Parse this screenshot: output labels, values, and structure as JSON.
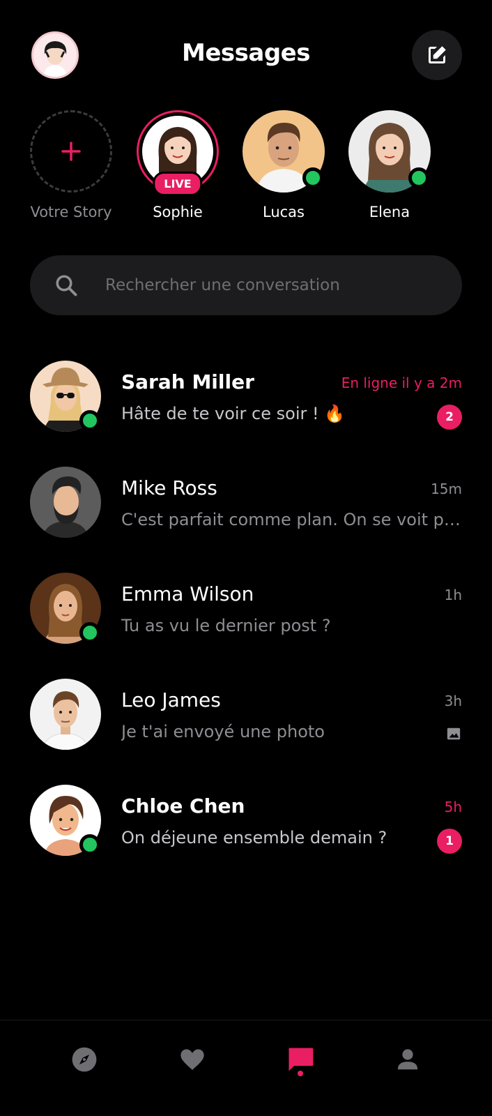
{
  "header": {
    "title": "Messages",
    "profile_icon": "user-avatar",
    "compose_icon": "edit-square-icon"
  },
  "stories": [
    {
      "name": "Votre Story",
      "type": "add",
      "icon": "plus-icon"
    },
    {
      "name": "Sophie",
      "type": "live",
      "badge": "LIVE"
    },
    {
      "name": "Lucas",
      "type": "online"
    },
    {
      "name": "Elena",
      "type": "online"
    }
  ],
  "search": {
    "placeholder": "Rechercher une conversation",
    "value": "",
    "icon": "search-icon"
  },
  "conversations": [
    {
      "name": "Sarah Miller",
      "preview": "Hâte de te voir ce soir ! 🔥",
      "time": "En ligne il y a 2m",
      "unread": "2",
      "online": true
    },
    {
      "name": "Mike Ross",
      "preview": "C'est parfait comme plan. On se voit plus tard.",
      "time": "15m",
      "online": false
    },
    {
      "name": "Emma Wilson",
      "preview": "Tu as vu le dernier post ?",
      "time": "1h",
      "online": true
    },
    {
      "name": "Leo James",
      "preview": "Je t'ai envoyé une photo",
      "time": "3h",
      "online": false,
      "attachment_icon": "image-icon"
    },
    {
      "name": "Chloe Chen",
      "preview": "On déjeune ensemble demain ?",
      "time": "5h",
      "unread": "1",
      "online": true
    }
  ],
  "bottom_nav": {
    "items": [
      "compass-icon",
      "heart-icon",
      "chat-bubble-icon",
      "person-icon"
    ],
    "active": "chat-bubble-icon"
  },
  "colors": {
    "accent": "#ea1e63",
    "online": "#22c55e",
    "background": "#000000",
    "surface": "#1c1c1e",
    "muted_text": "#8e8e93"
  }
}
